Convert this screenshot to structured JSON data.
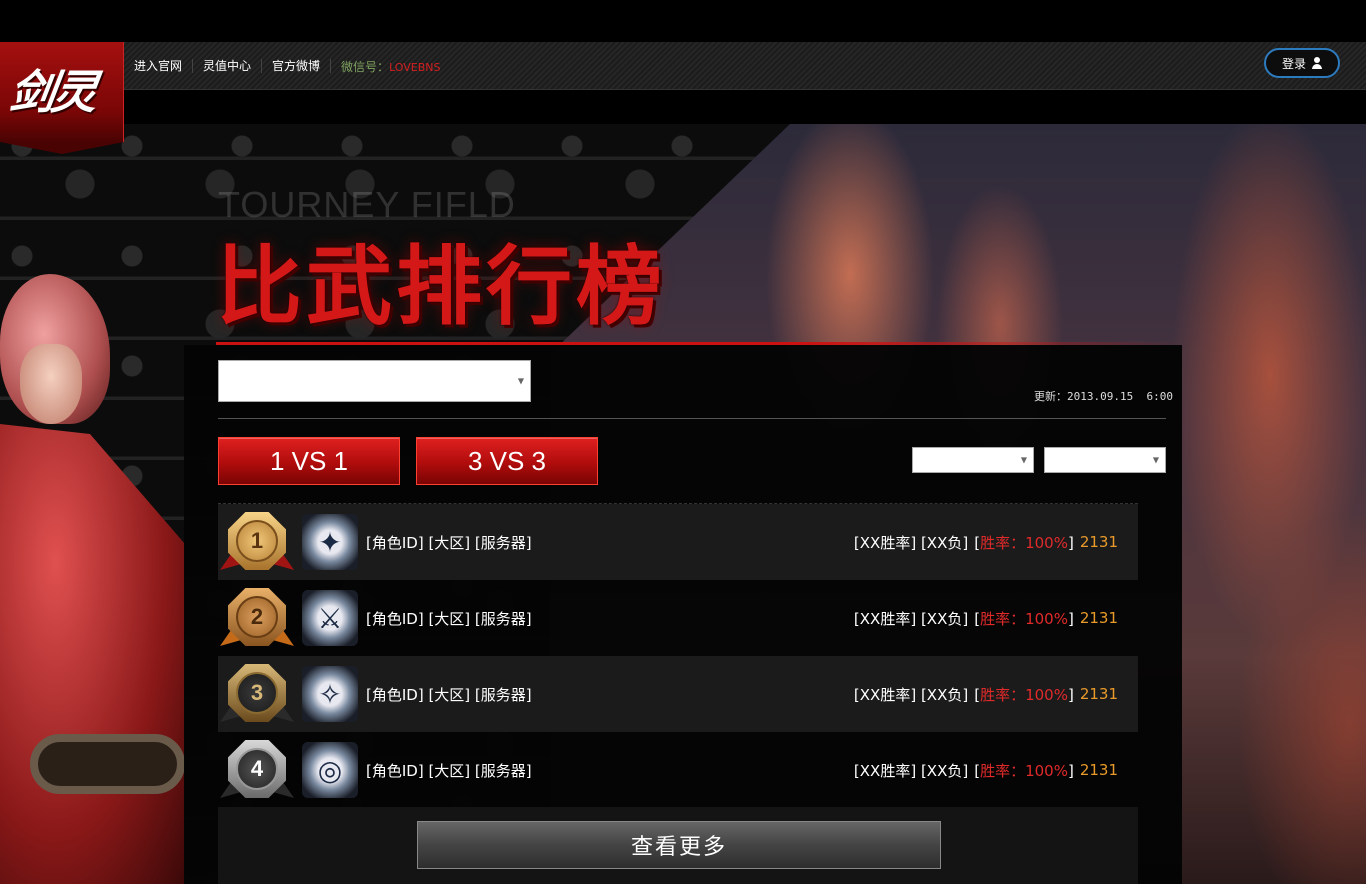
{
  "nav": {
    "logo_text": "剑灵",
    "items": [
      "进入官网",
      "灵值中心",
      "官方微博"
    ],
    "wechat_label": "微信号：",
    "wechat_id": "LOVEBNS",
    "login_label": "登录"
  },
  "banner": {
    "title_en": "TOURNEY FIFLD",
    "title_cn": "比武排行榜"
  },
  "panel": {
    "update_text": "更新：2013.09.15  6:00",
    "modes": [
      "1 VS 1",
      "3 VS 3"
    ],
    "more_label": "查看更多"
  },
  "rows": [
    {
      "rank": "1",
      "info": "[角色ID] [大区] [服务器]",
      "stats": "[XX胜率] [XX负]",
      "winrate": "胜率：100%",
      "score": "2131",
      "icon": "blade-master-icon"
    },
    {
      "rank": "2",
      "info": "[角色ID] [大区] [服务器]",
      "stats": "[XX胜率] [XX负]",
      "winrate": "胜率：100%",
      "score": "2131",
      "icon": "crossed-swords-icon"
    },
    {
      "rank": "3",
      "info": "[角色ID] [大区] [服务器]",
      "stats": "[XX胜率] [XX负]",
      "winrate": "胜率：100%",
      "score": "2131",
      "icon": "axe-icon"
    },
    {
      "rank": "4",
      "info": "[角色ID] [大区] [服务器]",
      "stats": "[XX胜率] [XX负]",
      "winrate": "胜率：100%",
      "score": "2131",
      "icon": "orb-icon"
    }
  ],
  "colors": {
    "accent_red": "#d41818",
    "login_border": "#2d7bbf",
    "winrate": "#e02a2a",
    "score": "#e89a2a"
  }
}
